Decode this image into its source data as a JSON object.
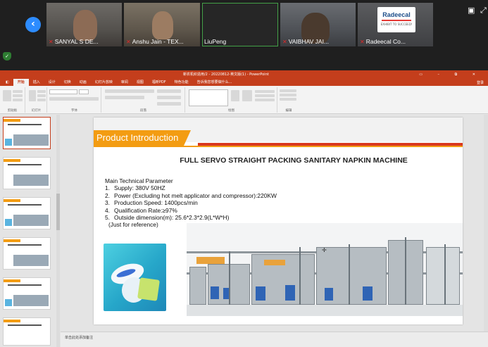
{
  "call": {
    "participants": [
      {
        "name": "SANYAL S DE...",
        "muted": true
      },
      {
        "name": "Anshu Jain - TEX...",
        "muted": true
      },
      {
        "name": "LiuPeng",
        "muted": false
      },
      {
        "name": "VAIBHAV JAI...",
        "muted": true
      },
      {
        "name": "Radeecal Co...",
        "muted": true
      }
    ],
    "logo_text": "Radeecal",
    "logo_sub": "EXHIBIT TO SUCCEED!"
  },
  "ppt": {
    "window_title": "新农机织造用/2 - 20220812-英文版(1) - PowerPoint",
    "tabs": [
      "开始",
      "插入",
      "设计",
      "切换",
      "动画",
      "幻灯片放映",
      "审阅",
      "视图",
      "福昕PDF",
      "特色功能"
    ],
    "tell_me": "告诉我您想要做什么...",
    "signin": "登录",
    "ribbon_groups": [
      "剪贴板",
      "幻灯片",
      "字体",
      "段落",
      "绘图",
      "编辑"
    ],
    "notes_placeholder": "单击此处添加备注"
  },
  "slide": {
    "section_title": "Product Introduction",
    "headline": "FULL SERVO STRAIGHT PACKING SANITARY NAPKIN MACHINE",
    "params_title": "Main Technical Parameter",
    "params": [
      {
        "num": "1.",
        "text": "Supply: 380V  50HZ"
      },
      {
        "num": "2.",
        "text": "Power (Excluding hot melt applicator and compressor):220KW"
      },
      {
        "num": "3.",
        "text": "Production Speed: 1400pcs/min"
      },
      {
        "num": "4.",
        "text": "Qualification Rate:≥97%"
      },
      {
        "num": "5.",
        "text": "Outside dimension(m): 25.6*2.3*2.9(L*W*H)"
      }
    ],
    "note": "(Just for reference)"
  },
  "colors": {
    "ppt_accent": "#c43e1c",
    "slide_orange": "#f39c12",
    "active_speaker": "#43a047"
  }
}
